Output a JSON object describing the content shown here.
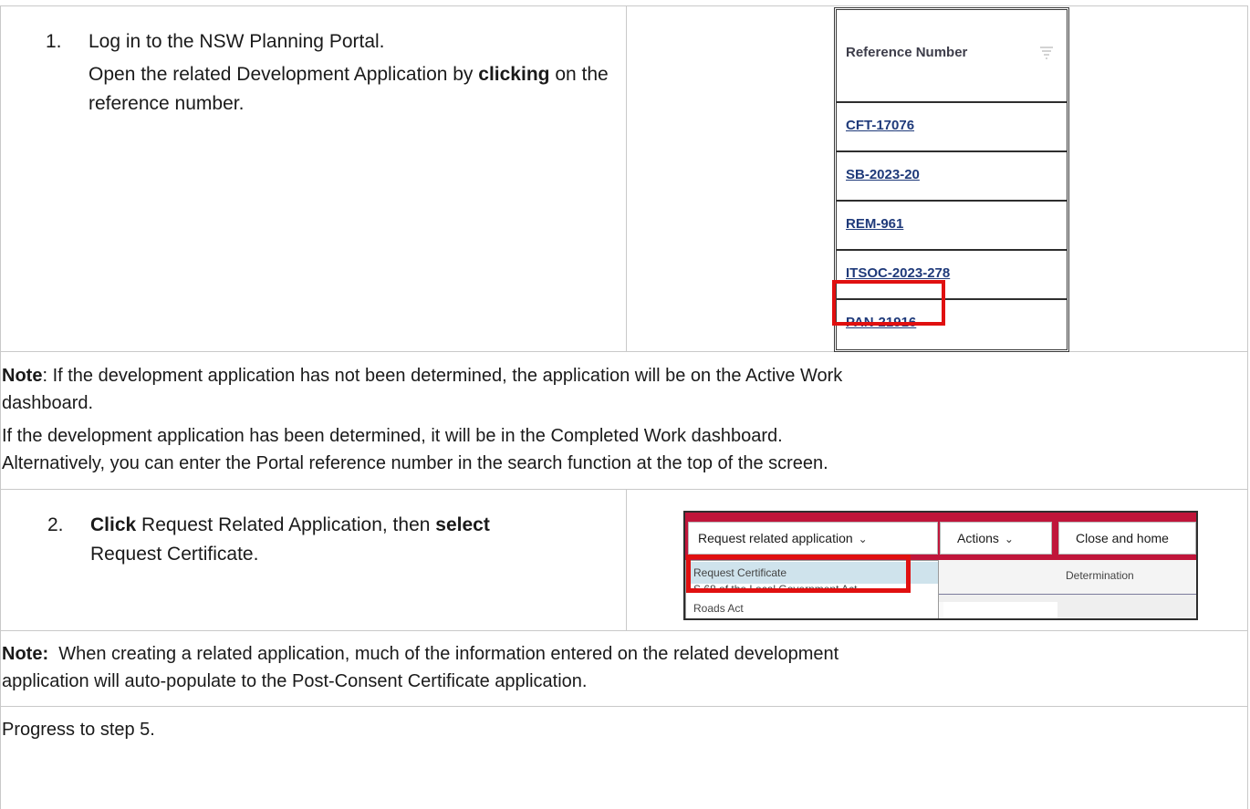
{
  "steps": [
    {
      "number": "1.",
      "line1": "Log in to the NSW Planning Portal.",
      "line2_pre": "Open the related Development Application by",
      "line2_bold": "clicking",
      "line2_post": " on the reference number."
    },
    {
      "number": "2.",
      "bold1": "Click",
      "text1": " Request Related Application, then ",
      "bold2": "select",
      "text2": "Request Certificate."
    }
  ],
  "reference_table": {
    "header": "Reference Number",
    "rows": [
      "CFT-17076",
      "SB-2023-20",
      "REM-961",
      "ITSOC-2023-278",
      "PAN-21916"
    ],
    "highlighted": "PAN-21916"
  },
  "note1": {
    "label": "Note",
    "line1": ": If the development application has not been determined, the application will be on the Active Work",
    "line2": "dashboard.",
    "line3": "If the development application has been determined, it will be in the Completed Work dashboard.",
    "line4": "Alternatively, you can enter the Portal reference number in the search function at the top of the screen."
  },
  "app_ui": {
    "request_button": "Request related application",
    "actions_button": "Actions",
    "close_button": "Close and home",
    "tab_label": "Determination",
    "menu_items": [
      "Request Certificate",
      "S.68 of the Local Government Act",
      "Roads Act"
    ],
    "highlighted_item": "Request Certificate",
    "accent_color": "#c0153a",
    "highlight_color": "#e01010"
  },
  "note2": {
    "label": "Note:",
    "line1": "  When creating a related application, much of the information entered on the related development",
    "line2": "application will auto-populate to the Post-Consent Certificate application."
  },
  "progress": "Progress to step 5."
}
